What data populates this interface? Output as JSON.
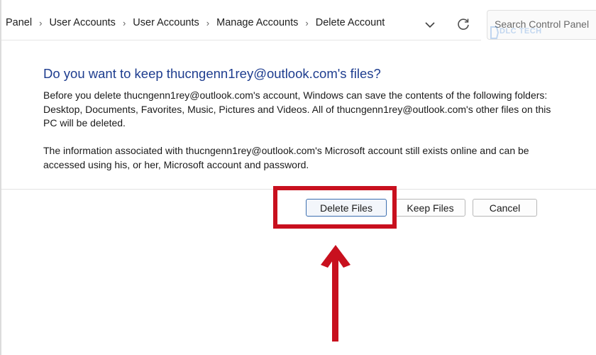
{
  "addressbar": {
    "breadcrumbs": [
      "Panel",
      "User Accounts",
      "User Accounts",
      "Manage Accounts",
      "Delete Account"
    ],
    "search_placeholder": "Search Control Panel"
  },
  "watermark": {
    "text": "DLC TECH"
  },
  "dialog": {
    "title": "Do you want to keep thucngenn1rey@outlook.com's files?",
    "paragraph1": "Before you delete thucngenn1rey@outlook.com's account, Windows can save the contents of the following folders: Desktop, Documents, Favorites, Music, Pictures and Videos. All of thucngenn1rey@outlook.com's other files on this PC will be deleted.",
    "paragraph2": "The information associated with thucngenn1rey@outlook.com's Microsoft account still exists online and can be accessed using his, or her, Microsoft account and password."
  },
  "buttons": {
    "delete_files": "Delete Files",
    "keep_files": "Keep Files",
    "cancel": "Cancel"
  },
  "annotation": {
    "color": "#c8101e"
  },
  "colors": {
    "title": "#1e3d8f",
    "focus_border": "#3c6fb0"
  }
}
